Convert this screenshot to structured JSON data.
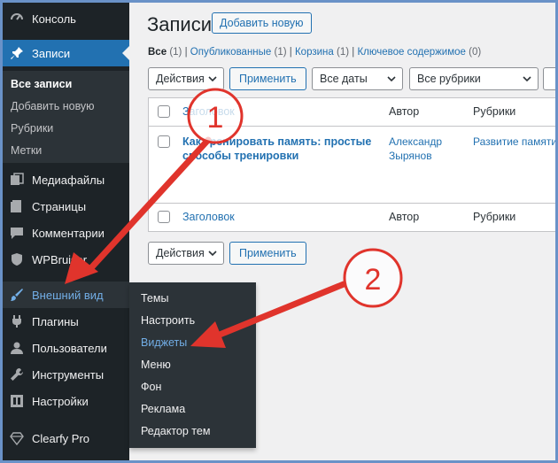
{
  "sidebar": {
    "items": [
      {
        "label": "Консоль",
        "icon": "dashboard-icon"
      },
      {
        "label": "Записи",
        "icon": "pin-icon"
      },
      {
        "label": "Медиафайлы",
        "icon": "media-icon"
      },
      {
        "label": "Страницы",
        "icon": "page-icon"
      },
      {
        "label": "Комментарии",
        "icon": "comment-icon"
      },
      {
        "label": "WPBruiser",
        "icon": "shield-icon"
      },
      {
        "label": "Внешний вид",
        "icon": "brush-icon"
      },
      {
        "label": "Плагины",
        "icon": "plugin-icon"
      },
      {
        "label": "Пользователи",
        "icon": "user-icon"
      },
      {
        "label": "Инструменты",
        "icon": "wrench-icon"
      },
      {
        "label": "Настройки",
        "icon": "settings-icon"
      },
      {
        "label": "Clearfy Pro",
        "icon": "diamond-icon"
      }
    ],
    "submenu": [
      "Все записи",
      "Добавить новую",
      "Рубрики",
      "Метки"
    ]
  },
  "flyout": [
    "Темы",
    "Настроить",
    "Виджеты",
    "Меню",
    "Фон",
    "Реклама",
    "Редактор тем"
  ],
  "header": {
    "title": "Записи",
    "add_new": "Добавить новую"
  },
  "filters": [
    {
      "label": "Все",
      "count": "(1)"
    },
    {
      "label": "Опубликованные",
      "count": "(1)"
    },
    {
      "label": "Корзина",
      "count": "(1)"
    },
    {
      "label": "Ключевое содержимое",
      "count": "(0)"
    }
  ],
  "toolbar": {
    "actions": "Действия",
    "apply": "Применить",
    "dates": "Все даты",
    "categories": "Все рубрики"
  },
  "table": {
    "columns": [
      "Заголовок",
      "Автор",
      "Рубрики"
    ],
    "row": {
      "title": "Как тренировать память: простые способы тренировки",
      "author": "Александр Зырянов",
      "category": "Развитие памяти"
    }
  },
  "annotations": [
    "1",
    "2"
  ],
  "colors": {
    "sidebar": "#1d2327",
    "accent": "#2271b1",
    "annotation": "#e0342c",
    "frame": "#6a92c8"
  }
}
